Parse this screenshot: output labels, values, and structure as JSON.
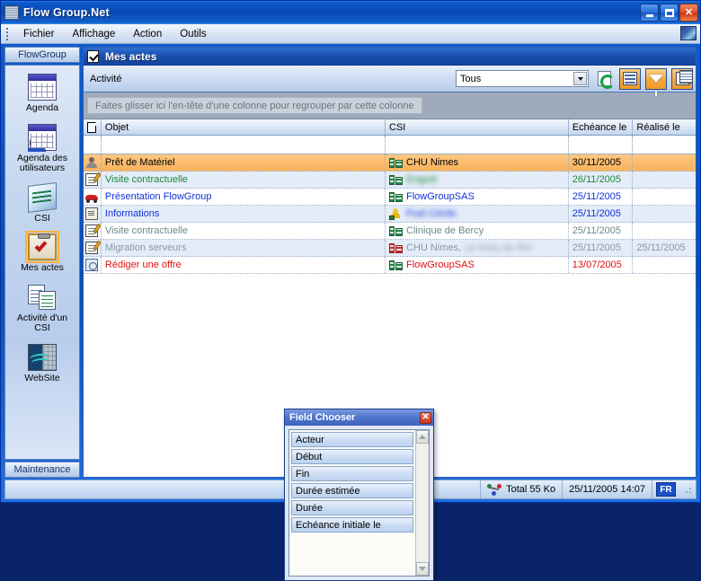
{
  "window": {
    "title": "Flow Group.Net",
    "icon": "app-grid-icon",
    "controls": {
      "minimize": "_",
      "maximize": "□",
      "close": "✕"
    }
  },
  "menubar": {
    "items": [
      "Fichier",
      "Affichage",
      "Action",
      "Outils"
    ],
    "right_icon": "app-module-icon"
  },
  "sidebar": {
    "top_bar": "FlowGroup",
    "bottom_bar": "Maintenance",
    "items": [
      {
        "label": "Agenda",
        "icon": "calendar-icon",
        "selected": false
      },
      {
        "label": "Agenda des utilisateurs",
        "icon": "users-calendar-icon",
        "selected": false
      },
      {
        "label": "CSI",
        "icon": "csi-card-icon",
        "selected": false
      },
      {
        "label": "Mes actes",
        "icon": "clipboard-check-icon",
        "selected": true
      },
      {
        "label": "Activité d'un CSI",
        "icon": "activity-sheets-icon",
        "selected": false
      },
      {
        "label": "WebSite",
        "icon": "website-globe-icon",
        "selected": false
      }
    ]
  },
  "panel": {
    "title": "Mes actes",
    "title_icon": "clipboard-check-icon"
  },
  "toolbar": {
    "filter_label": "Activité",
    "filter_value": "Tous",
    "filter_placeholder": "Tous",
    "buttons": [
      {
        "name": "refresh-button",
        "icon": "refresh-icon",
        "active": false
      },
      {
        "name": "columns-button",
        "icon": "columns-icon",
        "active": true
      },
      {
        "name": "filter-button",
        "icon": "funnel-icon",
        "active": true
      },
      {
        "name": "field-chooser-button",
        "icon": "field-chooser-icon",
        "active": true
      }
    ]
  },
  "group_panel": {
    "hint": "Faites glisser ici l'en-tête d'une colonne pour regrouper par cette colonne"
  },
  "grid": {
    "columns": [
      {
        "key": "icon",
        "label": "",
        "icon": "document-icon"
      },
      {
        "key": "objet",
        "label": "Objet"
      },
      {
        "key": "csi",
        "label": "CSI"
      },
      {
        "key": "ech",
        "label": "Echéance le"
      },
      {
        "key": "real",
        "label": "Réalisé le"
      }
    ],
    "rows": [
      {
        "icon": "user-icon",
        "objet": "Prêt de Matériel",
        "csi": "CHU Nimes",
        "csi_icon": "building-green-icon",
        "csi_blur": false,
        "csi_extra": "",
        "csi_extra_blur": false,
        "ech": "30/11/2005",
        "real": "",
        "style": "selected",
        "color": "t-black"
      },
      {
        "icon": "note-pen-icon",
        "objet": "Visite contractuelle",
        "csi": "Engedi",
        "csi_icon": "building-green-icon",
        "csi_blur": true,
        "csi_extra": "",
        "csi_extra_blur": false,
        "ech": "26/11/2005",
        "real": "",
        "style": "alt",
        "color": "t-green"
      },
      {
        "icon": "car-icon",
        "objet": "Présentation FlowGroup",
        "csi": "FlowGroupSAS",
        "csi_icon": "building-green-icon",
        "csi_blur": false,
        "csi_extra": "",
        "csi_extra_blur": false,
        "ech": "25/11/2005",
        "real": "",
        "style": "plain",
        "color": "t-blue"
      },
      {
        "icon": "info-icon",
        "objet": "Informations",
        "csi": "Puel Cécile",
        "csi_icon": "person-gold-icon",
        "csi_blur": true,
        "csi_extra": "",
        "csi_extra_blur": false,
        "ech": "25/11/2005",
        "real": "",
        "style": "alt",
        "color": "t-blue"
      },
      {
        "icon": "note-pen-icon",
        "objet": "Visite contractuelle",
        "csi": "Clinique de Bercy",
        "csi_icon": "building-green-icon",
        "csi_blur": false,
        "csi_extra": "",
        "csi_extra_blur": false,
        "ech": "25/11/2005",
        "real": "",
        "style": "plain",
        "color": "t-gray2"
      },
      {
        "icon": "note-pen-icon",
        "objet": "Migration serveurs",
        "csi": "CHU Nimes,",
        "csi_icon": "building-red-icon",
        "csi_blur": false,
        "csi_extra": "Le Grau du Roi",
        "csi_extra_blur": true,
        "ech": "25/11/2005",
        "real": "25/11/2005",
        "style": "alt",
        "color": "t-gray"
      },
      {
        "icon": "doc-circle-icon",
        "objet": "Rédiger une offre",
        "csi": "FlowGroupSAS",
        "csi_icon": "building-green-icon",
        "csi_blur": false,
        "csi_extra": "",
        "csi_extra_blur": false,
        "ech": "13/07/2005",
        "real": "",
        "style": "plain",
        "color": "t-red"
      }
    ]
  },
  "field_chooser": {
    "title": "Field Chooser",
    "close_label": "✕",
    "items": [
      "Acteur",
      "Début",
      "Fin",
      "Durée estimée",
      "Durée",
      "Echéance initiale le"
    ]
  },
  "statusbar": {
    "total": "Total 55 Ko",
    "datetime": "25/11/2005 14:07",
    "language": "FR",
    "network_icon": "network-status-icon"
  },
  "colors": {
    "titlebar_blue": "#0a49b4",
    "accent_orange": "#f7b25e",
    "selection_orange": "#ffc880",
    "panel_blue": "#1a4fae",
    "link_blue": "#1030d8",
    "overdue_red": "#e01010",
    "done_green": "#1a8a3a"
  }
}
